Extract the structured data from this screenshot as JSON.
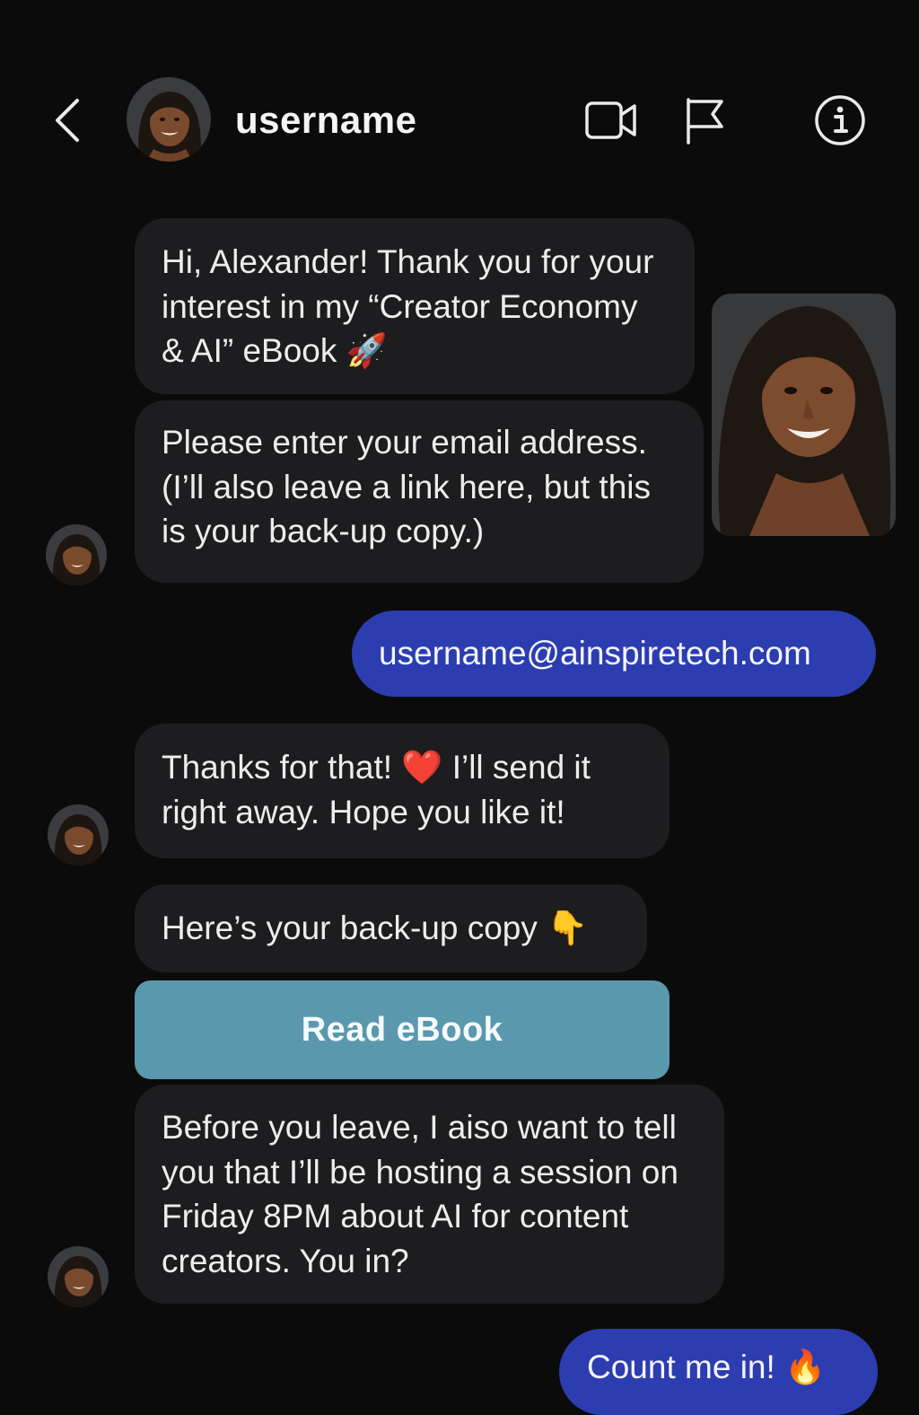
{
  "header": {
    "username": "username",
    "back_icon": "chevron-left-icon",
    "video_icon": "video-camera-icon",
    "flag_icon": "flag-icon",
    "info_icon": "info-icon"
  },
  "messages": {
    "m1": "Hi, Alexander! Thank you for your interest in my “Creator Economy & AI” eBook 🚀",
    "m2": "Please enter your email address. (I’ll also leave a link here, but this is your back-up copy.)",
    "sent_email": "username@ainspiretech.com",
    "m3": "Thanks for that! ❤️  I’ll send it right away. Hope you like it!",
    "m4": "Here’s your back-up copy 👇",
    "read_button": "Read eBook",
    "m5": "Before you leave, I aiso want to tell you that I’ll be hosting a session on Friday 8PM about AI for content creators. You in?",
    "sent_reply": "Count me in! 🔥"
  },
  "colors": {
    "background": "#0b0b0c",
    "received_bubble": "#1d1d1f",
    "sent_bubble": "#2c3db0",
    "read_button": "#5a98ae"
  }
}
